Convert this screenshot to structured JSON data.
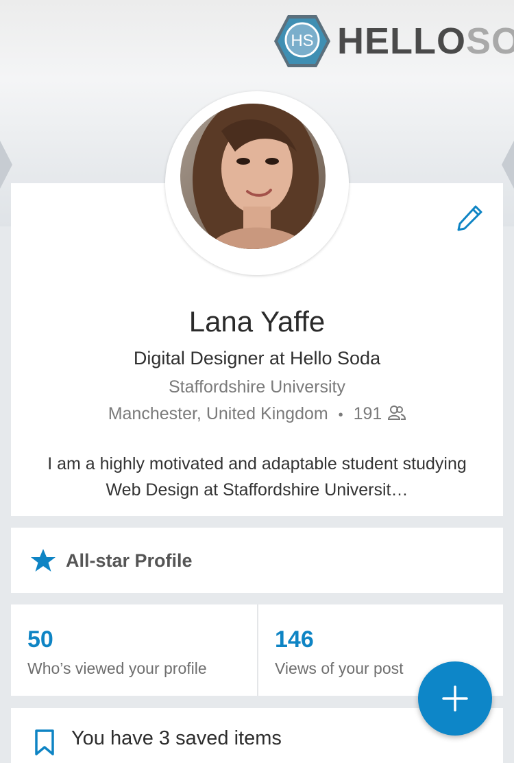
{
  "banner": {
    "logo_badge": "HS",
    "logo_text_main": "HELLO",
    "logo_text_fade": "SODA"
  },
  "profile": {
    "name": "Lana Yaffe",
    "headline": "Digital Designer at Hello Soda",
    "school": "Staffordshire University",
    "location": "Manchester, United Kingdom",
    "separator": "•",
    "connections": "191",
    "summary": "I am a highly motivated and adaptable student studying Web Design at Staffordshire Universit…"
  },
  "allstar": {
    "label": "All-star Profile"
  },
  "stats": [
    {
      "value": "50",
      "label": "Who’s viewed your profile"
    },
    {
      "value": "146",
      "label": "Views of your post"
    }
  ],
  "saved": {
    "label": "You have 3 saved items"
  },
  "icons": {
    "edit": "pencil-icon",
    "connections": "people-icon",
    "allstar": "star-icon",
    "saved": "bookmark-icon",
    "fab": "plus-icon"
  },
  "colors": {
    "accent": "#0e84c4",
    "fab": "#0d86c8",
    "background": "#e6e9ec"
  }
}
